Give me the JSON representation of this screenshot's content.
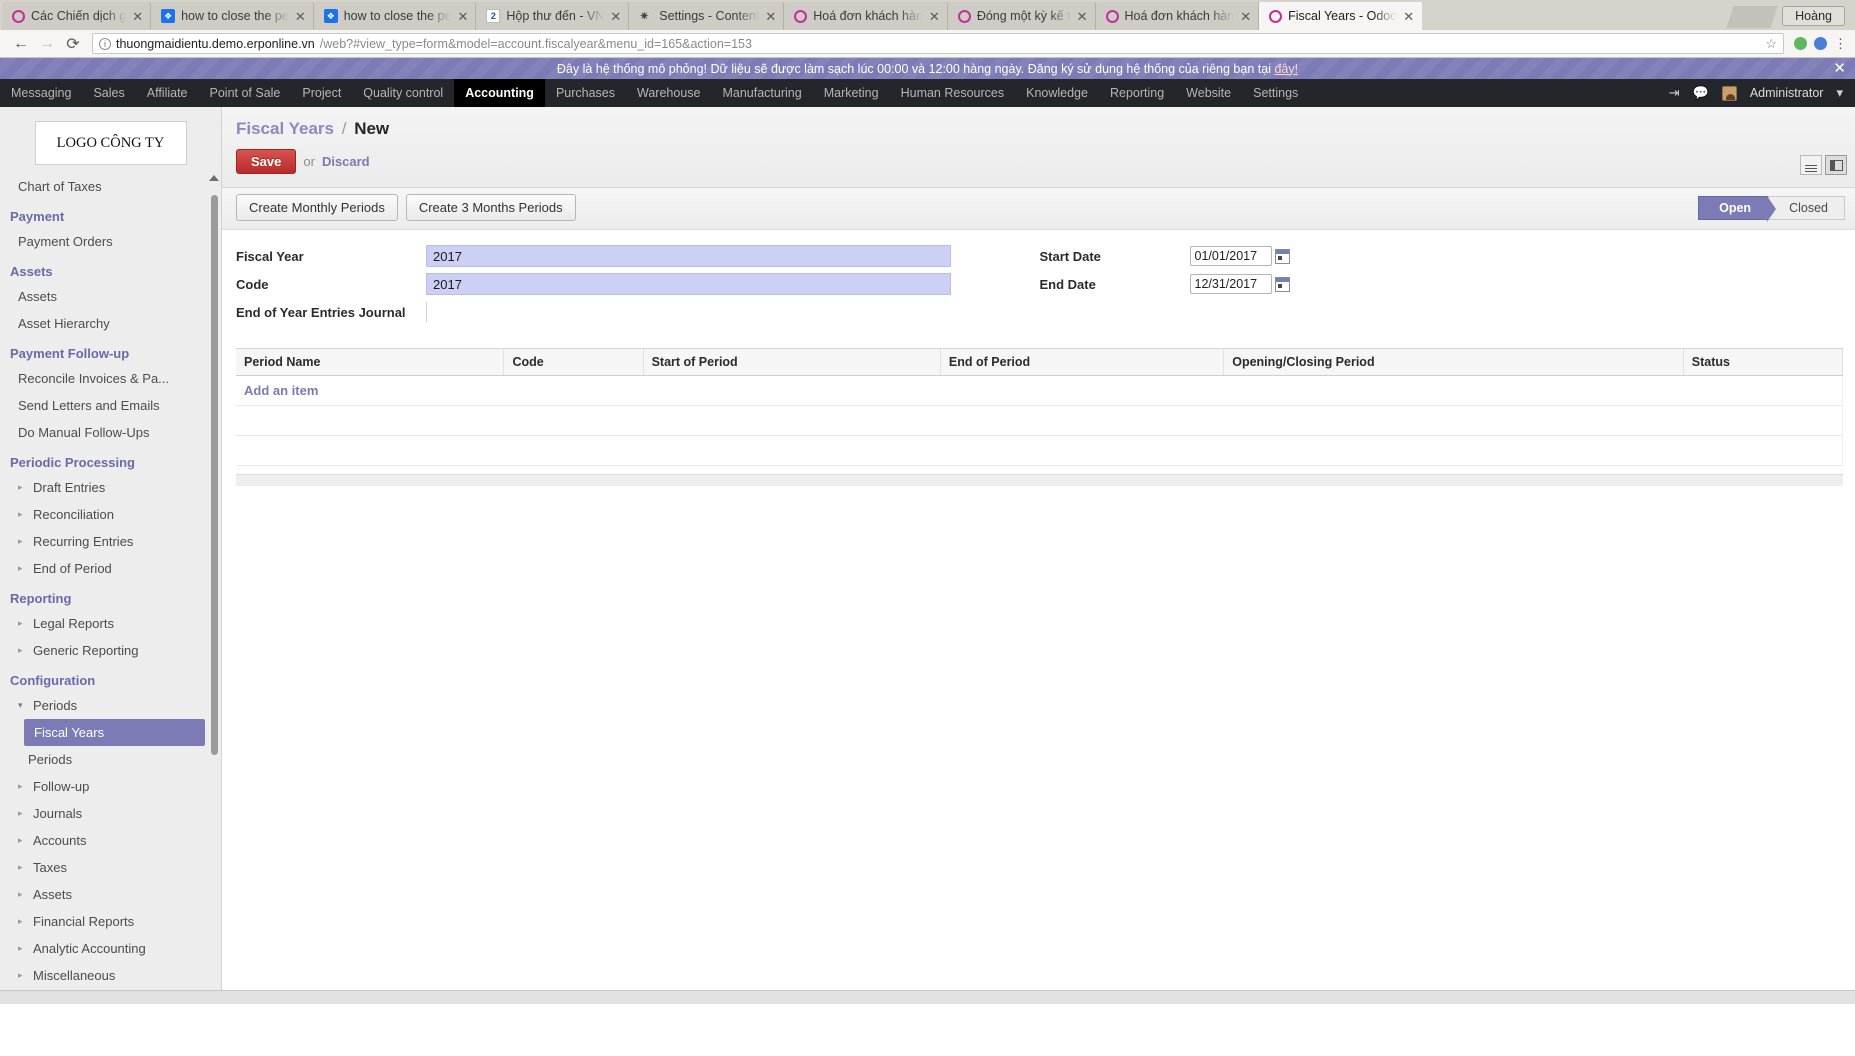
{
  "browser": {
    "tabs": [
      {
        "title": "Các Chiến dịch g",
        "icon": "odoo-circle-icon",
        "active": false
      },
      {
        "title": "how to close the pe",
        "icon": "blue-doc-icon",
        "active": false
      },
      {
        "title": "how to close the pe",
        "icon": "blue-doc-icon",
        "active": false
      },
      {
        "title": "Hộp thư đến - VN",
        "icon": "mail-icon",
        "active": false
      },
      {
        "title": "Settings - Content",
        "icon": "gear-icon",
        "active": false
      },
      {
        "title": "Hoá đơn khách hàn",
        "icon": "odoo-circle-icon",
        "active": false
      },
      {
        "title": "Đóng một kỳ kế t",
        "icon": "odoo-circle-icon",
        "active": false
      },
      {
        "title": "Hoá đơn khách hàn",
        "icon": "odoo-circle-icon",
        "active": false
      },
      {
        "title": "Fiscal Years - Odoo",
        "icon": "odoo-circle-icon",
        "active": true
      }
    ],
    "tab_close_glyph": "✕",
    "profile_name": "Hoàng",
    "nav": {
      "back": "←",
      "forward": "→",
      "reload": "⟳"
    },
    "url": {
      "host": "thuongmaidientu.demo.erponline.vn",
      "path": "/web?#view_type=form&model=account.fiscalyear&menu_id=165&action=153",
      "info_glyph": "i",
      "star_glyph": "☆"
    }
  },
  "banner": {
    "text": "Đây là hệ thống mô phỏng! Dữ liệu sẽ được làm sạch lúc 00:00 và 12:00 hàng ngày. Đăng ký sử dụng hệ thống của riêng bạn tại ",
    "link": "đây!",
    "close": "✕"
  },
  "topmenu": {
    "items": [
      {
        "label": "Messaging",
        "active": false
      },
      {
        "label": "Sales",
        "active": false
      },
      {
        "label": "Affiliate",
        "active": false
      },
      {
        "label": "Point of Sale",
        "active": false
      },
      {
        "label": "Project",
        "active": false
      },
      {
        "label": "Quality control",
        "active": false
      },
      {
        "label": "Accounting",
        "active": true
      },
      {
        "label": "Purchases",
        "active": false
      },
      {
        "label": "Warehouse",
        "active": false
      },
      {
        "label": "Manufacturing",
        "active": false
      },
      {
        "label": "Marketing",
        "active": false
      },
      {
        "label": "Human Resources",
        "active": false
      },
      {
        "label": "Knowledge",
        "active": false
      },
      {
        "label": "Reporting",
        "active": false
      },
      {
        "label": "Website",
        "active": false
      },
      {
        "label": "Settings",
        "active": false
      }
    ],
    "logout_glyph": "⇥",
    "chat_glyph": "💬",
    "user": "Administrator",
    "caret": "▾"
  },
  "sidebar": {
    "logo": "LOGO CÔNG TY",
    "items": [
      {
        "label": "Chart of Taxes",
        "type": "link"
      },
      {
        "label": "Payment",
        "type": "head"
      },
      {
        "label": "Payment Orders",
        "type": "link"
      },
      {
        "label": "Assets",
        "type": "head"
      },
      {
        "label": "Assets",
        "type": "link"
      },
      {
        "label": "Asset Hierarchy",
        "type": "link"
      },
      {
        "label": "Payment Follow-up",
        "type": "head"
      },
      {
        "label": "Reconcile Invoices & Pa...",
        "type": "link"
      },
      {
        "label": "Send Letters and Emails",
        "type": "link"
      },
      {
        "label": "Do Manual Follow-Ups",
        "type": "link"
      },
      {
        "label": "Periodic Processing",
        "type": "head"
      },
      {
        "label": "Draft Entries",
        "type": "expand"
      },
      {
        "label": "Reconciliation",
        "type": "expand"
      },
      {
        "label": "Recurring Entries",
        "type": "expand"
      },
      {
        "label": "End of Period",
        "type": "expand"
      },
      {
        "label": "Reporting",
        "type": "head"
      },
      {
        "label": "Legal Reports",
        "type": "expand"
      },
      {
        "label": "Generic Reporting",
        "type": "expand"
      },
      {
        "label": "Configuration",
        "type": "head"
      },
      {
        "label": "Periods",
        "type": "open"
      },
      {
        "label": "Fiscal Years",
        "type": "selected"
      },
      {
        "label": "Periods",
        "type": "sub"
      },
      {
        "label": "Follow-up",
        "type": "expand"
      },
      {
        "label": "Journals",
        "type": "expand"
      },
      {
        "label": "Accounts",
        "type": "expand"
      },
      {
        "label": "Taxes",
        "type": "expand"
      },
      {
        "label": "Assets",
        "type": "expand"
      },
      {
        "label": "Financial Reports",
        "type": "expand"
      },
      {
        "label": "Analytic Accounting",
        "type": "expand"
      },
      {
        "label": "Miscellaneous",
        "type": "expand"
      }
    ],
    "caret_right": "▸",
    "caret_down": "▾"
  },
  "page": {
    "breadcrumb_root": "Fiscal Years",
    "breadcrumb_sep": "/",
    "breadcrumb_current": "New",
    "save_label": "Save",
    "or_label": "or",
    "discard_label": "Discard",
    "buttons": [
      {
        "label": "Create Monthly Periods"
      },
      {
        "label": "Create 3 Months Periods"
      }
    ],
    "status": [
      {
        "label": "Open",
        "active": true
      },
      {
        "label": "Closed",
        "active": false
      }
    ],
    "fields": {
      "fiscal_year_label": "Fiscal Year",
      "fiscal_year_value": "2017",
      "code_label": "Code",
      "code_value": "2017",
      "end_of_year_journal_label": "End of Year Entries Journal",
      "end_of_year_journal_value": "",
      "start_date_label": "Start Date",
      "start_date_value": "01/01/2017",
      "end_date_label": "End Date",
      "end_date_value": "12/31/2017"
    },
    "table": {
      "columns": [
        "Period Name",
        "Code",
        "Start of Period",
        "End of Period",
        "Opening/Closing Period",
        "Status"
      ],
      "rows": [],
      "add_item_label": "Add an item"
    }
  }
}
